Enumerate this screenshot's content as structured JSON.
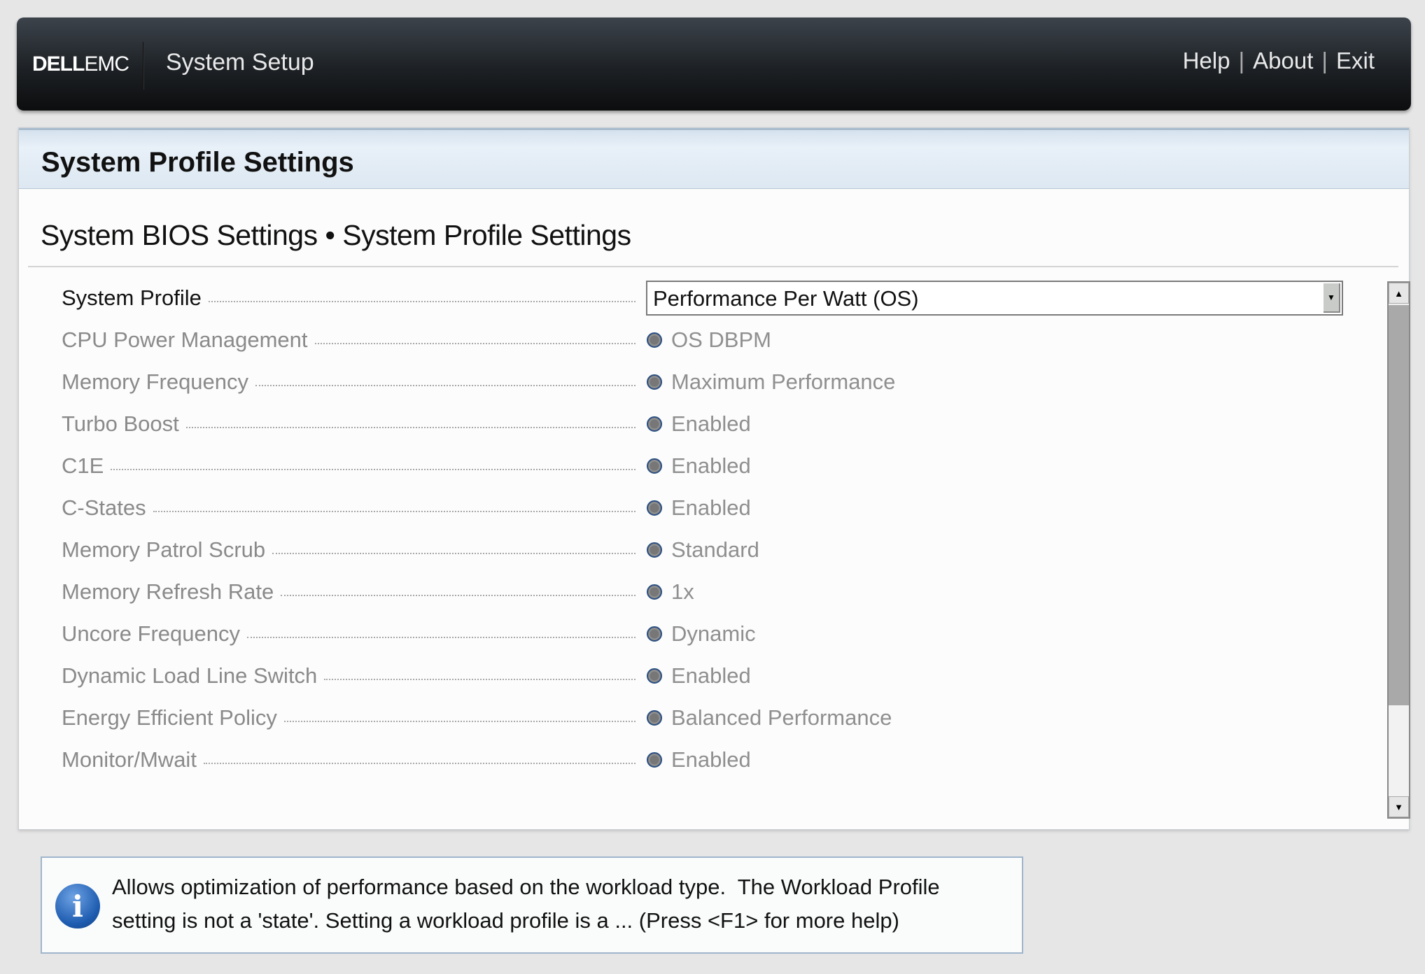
{
  "header": {
    "logo": "DELLEMC",
    "logo_bold": "DELL",
    "logo_light": "EMC",
    "title": "System Setup",
    "links": [
      "Help",
      "About",
      "Exit"
    ]
  },
  "panel": {
    "title": "System Profile Settings",
    "breadcrumb": "System BIOS Settings • System Profile Settings"
  },
  "settings": [
    {
      "label": "System Profile",
      "value": "Performance Per Watt (OS)",
      "type": "dropdown"
    },
    {
      "label": "CPU Power Management",
      "value": "OS DBPM"
    },
    {
      "label": "Memory Frequency",
      "value": "Maximum Performance"
    },
    {
      "label": "Turbo Boost",
      "value": "Enabled"
    },
    {
      "label": "C1E",
      "value": "Enabled"
    },
    {
      "label": "C-States",
      "value": "Enabled"
    },
    {
      "label": "Memory Patrol Scrub",
      "value": "Standard"
    },
    {
      "label": "Memory Refresh Rate",
      "value": "1x"
    },
    {
      "label": "Uncore Frequency",
      "value": "Dynamic"
    },
    {
      "label": "Dynamic Load Line Switch",
      "value": "Enabled"
    },
    {
      "label": "Energy Efficient Policy",
      "value": "Balanced Performance"
    },
    {
      "label": "Monitor/Mwait",
      "value": "Enabled"
    }
  ],
  "help": {
    "text": "Allows optimization of performance based on the workload type.  The Workload Profile\nsetting is not a 'state'. Setting a workload profile is a ... (Press <F1> for more help)"
  },
  "icons": {
    "info": "info-icon",
    "dropdown": "chevron-down-icon"
  }
}
